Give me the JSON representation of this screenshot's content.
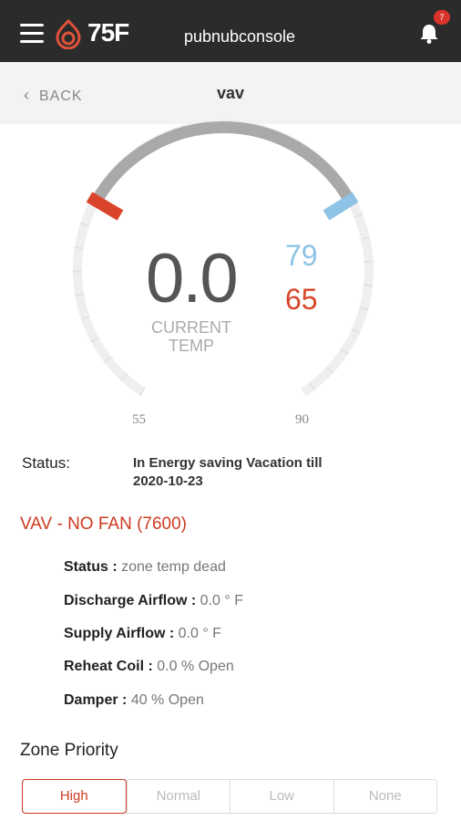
{
  "header": {
    "logo_text": "75F",
    "title": "pubnubconsole",
    "notification_count": "7"
  },
  "subheader": {
    "back_label": "BACK",
    "title": "vav"
  },
  "gauge": {
    "current_temp": "0.0",
    "current_label_line1": "CURRENT",
    "current_label_line2": "TEMP",
    "cooling_setpoint": "79",
    "heating_setpoint": "65",
    "range_min": "55",
    "range_max": "90",
    "colors": {
      "cool": "#8ec3e6",
      "heat": "#d9452b",
      "arc": "#a9a9a9",
      "track": "#eeeeee"
    }
  },
  "status": {
    "label": "Status:",
    "value_line1": "In Energy saving Vacation till",
    "value_line2": "2020-10-23"
  },
  "equipment": {
    "heading": "VAV - NO FAN (7600)",
    "details": [
      {
        "label": "Status :",
        "value": "zone temp dead"
      },
      {
        "label": "Discharge Airflow :",
        "value": "0.0 ° F"
      },
      {
        "label": "Supply Airflow :",
        "value": "0.0 ° F"
      },
      {
        "label": "Reheat Coil :",
        "value": "0.0 % Open"
      },
      {
        "label": "Damper :",
        "value": "40 % Open"
      }
    ]
  },
  "zone_priority": {
    "label": "Zone Priority",
    "options": [
      "High",
      "Normal",
      "Low",
      "None"
    ],
    "selected": "High",
    "accent": "#cc3a1f"
  }
}
